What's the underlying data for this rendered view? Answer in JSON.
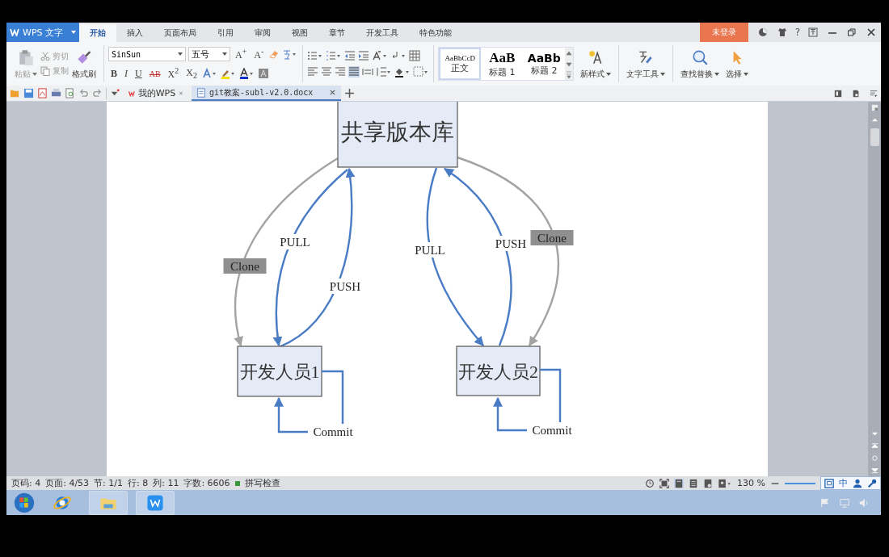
{
  "app_button": {
    "label": "WPS 文字"
  },
  "menu_tabs": [
    {
      "label": "开始",
      "selected": true
    },
    {
      "label": "插入",
      "selected": false
    },
    {
      "label": "页面布局",
      "selected": false
    },
    {
      "label": "引用",
      "selected": false
    },
    {
      "label": "审阅",
      "selected": false
    },
    {
      "label": "视图",
      "selected": false
    },
    {
      "label": "章节",
      "selected": false
    },
    {
      "label": "开发工具",
      "selected": false
    },
    {
      "label": "特色功能",
      "selected": false
    }
  ],
  "login": "未登录",
  "help": "?",
  "ribbon": {
    "paste": "粘贴",
    "cut": "剪切",
    "copy": "复制",
    "format_painter": "格式刷",
    "font": "SinSun",
    "font_size": "五号",
    "font_buttons": [
      "A$^{+}$",
      "A$^{-}$"
    ],
    "format_buttons": [
      "B",
      "I",
      "U",
      "AB",
      "X$^{2}$",
      "X$_{2}$"
    ],
    "styles": [
      {
        "preview": "AaBbCcD",
        "label": "正文",
        "selected": true
      },
      {
        "preview": "AaB",
        "label": "标题 1",
        "selected": false
      },
      {
        "preview": "AaBb",
        "label": "标题 2",
        "selected": false
      }
    ],
    "new_style": "新样式",
    "text_tools": "文字工具",
    "find_replace": "查找替换",
    "select": "选择"
  },
  "doc_tabs": [
    {
      "label": "我的WPS",
      "selected": false
    },
    {
      "label": "git教案-subl-v2.0.docx",
      "selected": true
    }
  ],
  "diagram": {
    "nodes": [
      {
        "label": "共享版本库"
      },
      {
        "label": "开发人员1"
      },
      {
        "label": "开发人员2"
      }
    ],
    "edges": [
      {
        "kind": "clone",
        "label": "Clone"
      },
      {
        "kind": "pull",
        "label": "PULL"
      },
      {
        "kind": "push",
        "label": "PUSH"
      },
      {
        "kind": "pull",
        "label": "PULL"
      },
      {
        "kind": "push",
        "label": "PUSH"
      },
      {
        "kind": "clone",
        "label": "Clone"
      }
    ],
    "commits": [
      {
        "label": "Commit"
      },
      {
        "label": "Commit"
      }
    ]
  },
  "status_bar": {
    "items": [
      "页码: 4",
      "页面: 4/53",
      "节: 1/1",
      "行: 8",
      "列: 11",
      "字数: 6606"
    ],
    "spell_check": "拼写检查",
    "zoom": "130 %",
    "ime_mode": "中"
  }
}
